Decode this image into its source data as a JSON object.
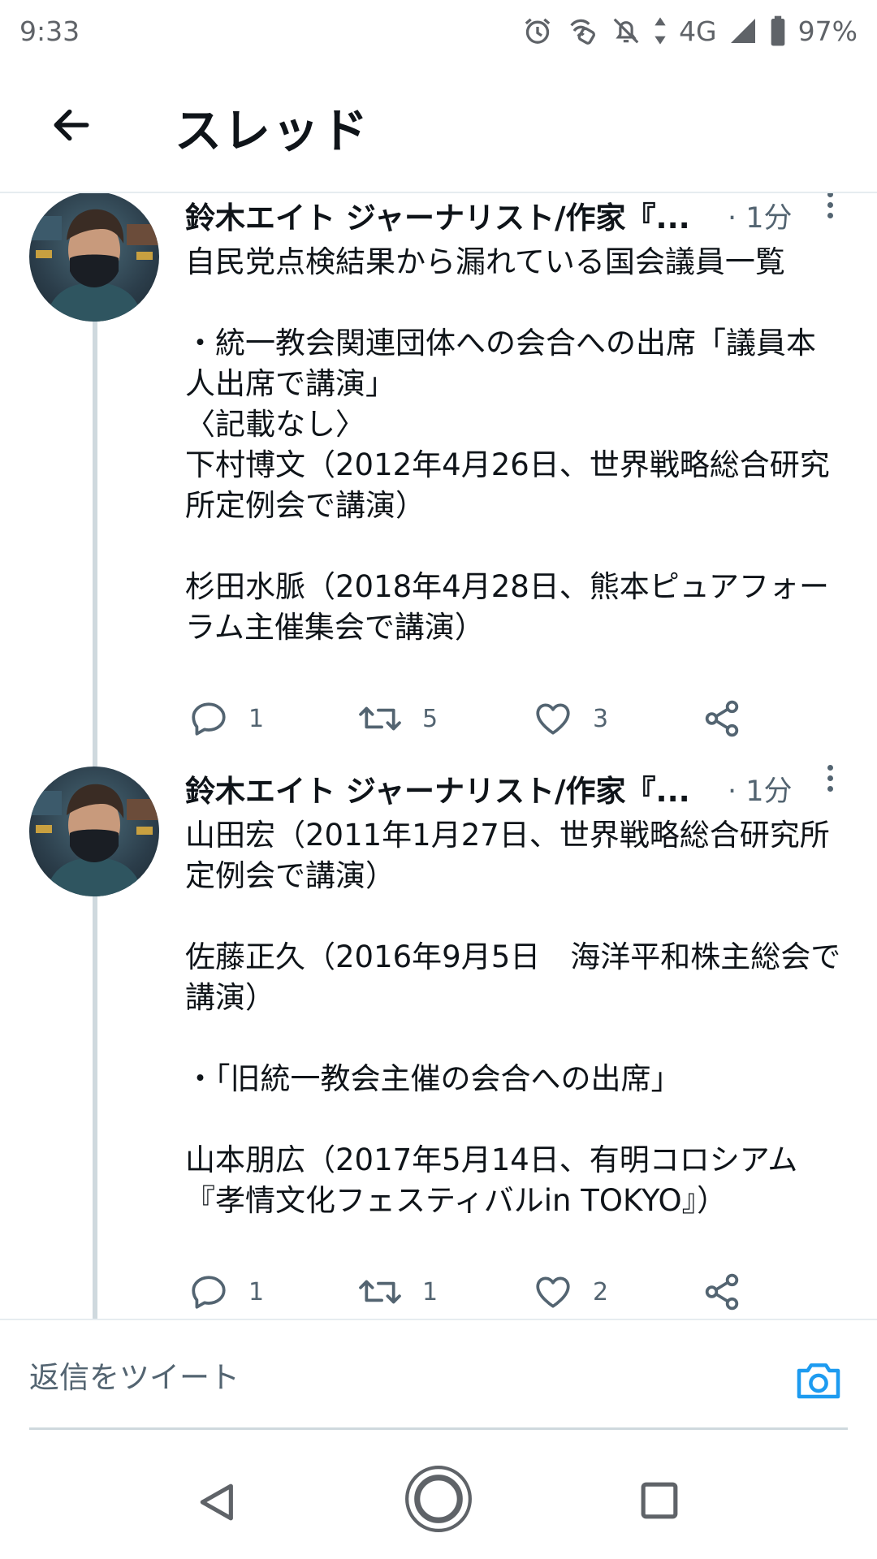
{
  "status_bar": {
    "time": "9:33",
    "network": "4G",
    "battery": "97%"
  },
  "header": {
    "title": "スレッド"
  },
  "tweets": [
    {
      "author": "鈴木エイト ジャーナリスト/作家『...",
      "time": "· 1分",
      "lines": [
        "自民党点検結果から漏れている国会議員一覧",
        "",
        "・統一教会関連団体への会合への出席「議員本",
        "人出席で講演」",
        "〈記載なし〉",
        "下村博文（2012年4月26日、世界戦略総合研究",
        "所定例会で講演）",
        "",
        "杉田水脈（2018年4月28日、熊本ピュアフォー",
        "ラム主催集会で講演）"
      ],
      "replies": "1",
      "retweets": "5",
      "likes": "3"
    },
    {
      "author": "鈴木エイト ジャーナリスト/作家『...",
      "time": "· 1分",
      "lines": [
        "山田宏（2011年1月27日、世界戦略総合研究所",
        "定例会で講演）",
        "",
        "佐藤正久（2016年9月5日　海洋平和株主総会で",
        "講演）",
        "",
        "・「旧統一教会主催の会合への出席」",
        "",
        "山本朋広（2017年5月14日、有明コロシアム",
        "『孝情文化フェスティバルin TOKYO』）"
      ],
      "replies": "1",
      "retweets": "1",
      "likes": "2"
    }
  ],
  "reply_bar": {
    "placeholder": "返信をツイート"
  },
  "colors": {
    "accent": "#1d9bf0",
    "secondary_text": "#536471",
    "thread_line": "#cfd9de"
  }
}
